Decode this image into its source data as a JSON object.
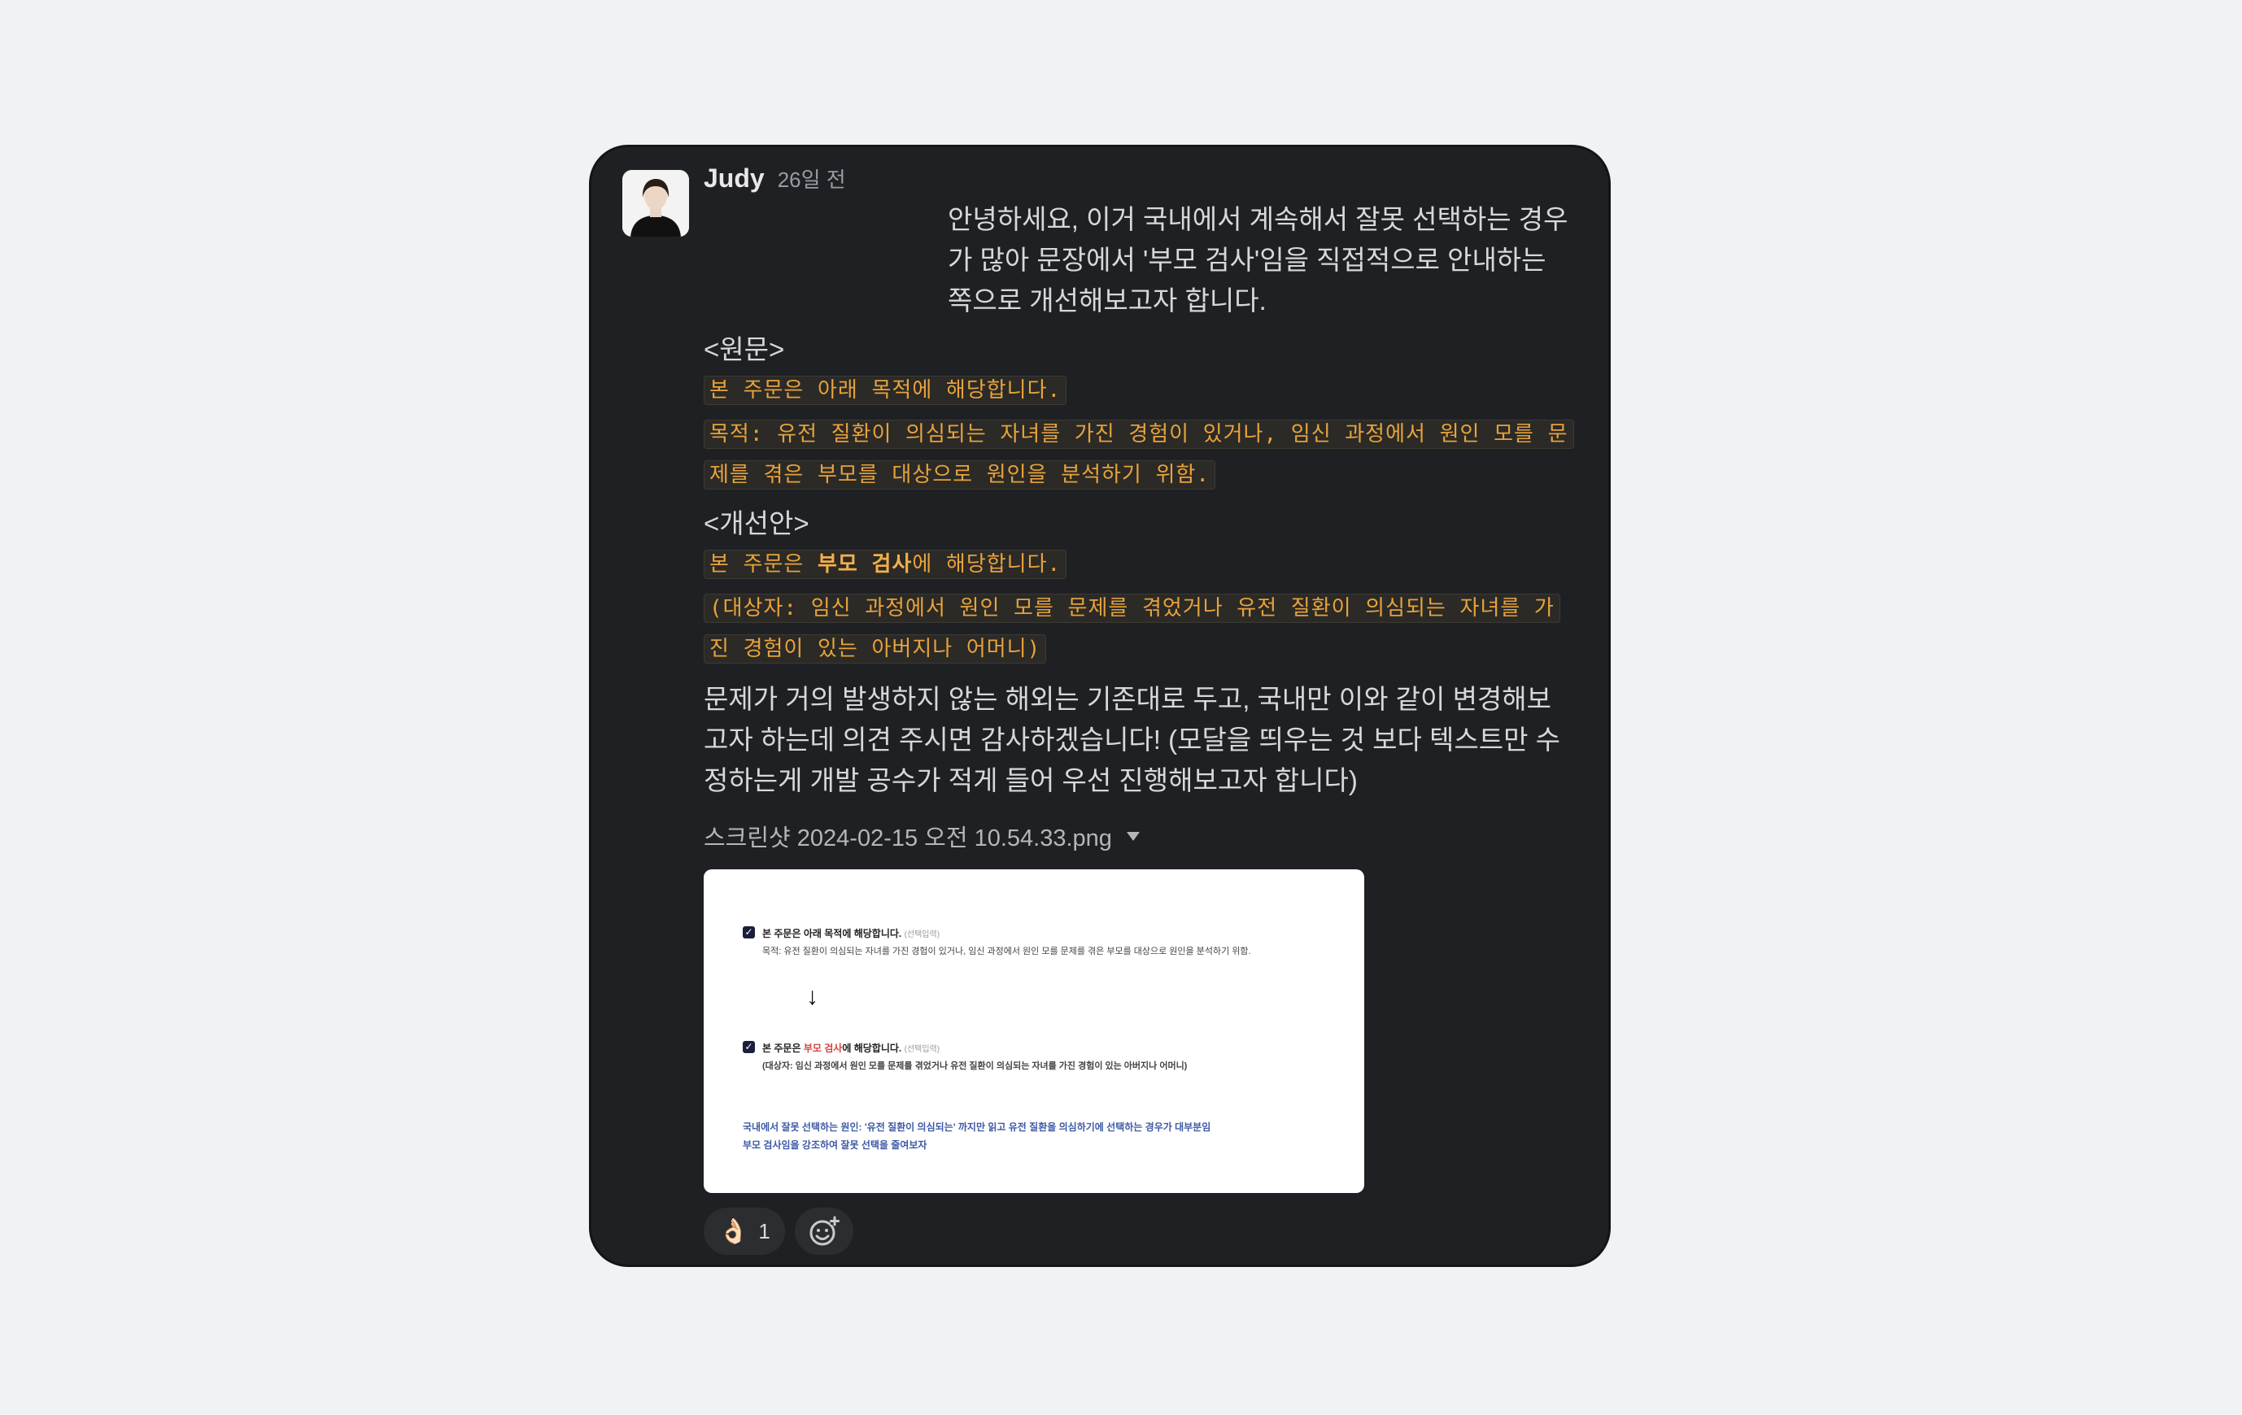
{
  "message": {
    "author": "Judy",
    "time": "26일 전",
    "intro": "안녕하세요, 이거 국내에서 계속해서 잘못 선택하는 경우가 많아 문장에서 '부모 검사'임을 직접적으로 안내하는 쪽으로 개선해보고자 합니다.",
    "original_title": "<원문>",
    "original_lines": [
      "본 주문은 아래 목적에 해당합니다.",
      "목적: 유전 질환이 의심되는 자녀를 가진 경험이 있거나, 임신 과정에서 원인 모를 문제를 겪은 부모를 대상으로 원인을 분석하기 위함."
    ],
    "improved_title": "<개선안>",
    "improved_line1_pre": "본 주문은 ",
    "improved_line1_bold": "부모 검사",
    "improved_line1_post": "에 해당합니다.",
    "improved_line2": "(대상자: 임신 과정에서 원인 모를 문제를 겪었거나 유전 질환이 의심되는 자녀를 가진 경험이 있는 아버지나 어머니)",
    "closing": "문제가 거의 발생하지 않는 해외는 기존대로 두고, 국내만 이와 같이 변경해보고자 하는데 의견 주시면 감사하겠습니다! (모달을 띄우는 것 보다 텍스트만 수정하는게 개발 공수가 적게 들어 우선 진행해보고자 합니다)",
    "attachment_name": "스크린샷 2024-02-15 오전 10.54.33.png"
  },
  "preview": {
    "row1_title": "본 주문은 아래 목적에 해당합니다.",
    "row1_tag": "(선택입력)",
    "row1_sub": "목적: 유전 질환이 의심되는 자녀를 가진 경험이 있거나, 임신 과정에서 원인 모를 문제를 겪은 부모를 대상으로 원인을 분석하기 위함.",
    "row2_pre": "본 주문은 ",
    "row2_red": "부모 검사",
    "row2_post": "에 해당합니다.",
    "row2_tag": "(선택입력)",
    "row2_sub": "(대상자: 임신 과정에서 원인 모를 문제를 겪었거나 유전 질환이 의심되는 자녀를 가진 경험이 있는 아버지나 어머니)",
    "note1": "국내에서 잘못 선택하는 원인: '유전 질환이 의심되는' 까지만 읽고 유전 질환을 의심하기에 선택하는 경우가 대부분임",
    "note2": "부모 검사임을 강조하여 잘못 선택을 줄여보자"
  },
  "reactions": [
    {
      "emoji": "👌🏻",
      "count": "1"
    }
  ],
  "icons": {
    "add_reaction": "add-emoji-icon",
    "attachment_toggle": "caret-down-icon"
  },
  "colors": {
    "card_bg": "#1f2023",
    "code_text": "#e8a23c",
    "page_bg": "#f0f2f6"
  }
}
